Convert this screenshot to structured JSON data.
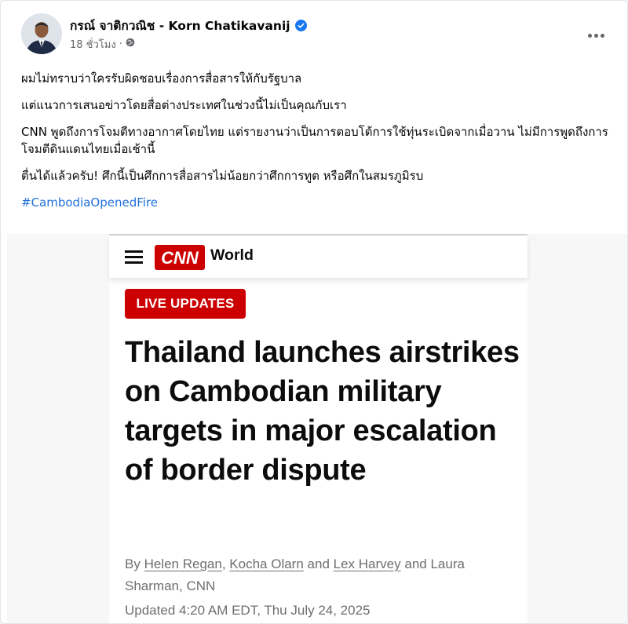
{
  "post": {
    "author_name": "กรณ์ จาติกวณิช - Korn Chatikavanij",
    "timestamp": "18 ชั่วโมง",
    "separator": "·",
    "paragraphs": [
      "ผมไม่ทราบว่าใครรับผิดชอบเรื่องการสื่อสารให้กับรัฐบาล",
      "แต่แนวการเสนอข่าวโดยสื่อต่างประเทศในช่วงนี้ไม่เป็นคุณกับเรา",
      "CNN พูดถึงการโจมตีทางอากาศโดยไทย แต่รายงานว่าเป็นการตอบโต้การใช้ทุ่นระเบิดจากเมื่อวาน ไม่มีการพูดถึงการโจมตีดินแดนไทยเมื่อเช้านี้",
      "ตื่นได้แล้วครับ! ศึกนี้เป็นศึกการสื่อสารไม่น้อยกว่าศึกการทูต หรือศึกในสมรภูมิรบ"
    ],
    "hashtag": "#CambodiaOpenedFire",
    "icons": {
      "verified": "verified-badge-icon",
      "audience": "globe-icon",
      "menu": "more-options-icon"
    }
  },
  "article": {
    "logo_text": "CNN",
    "section": "World",
    "badge": "LIVE UPDATES",
    "headline": "Thailand launches airstrikes on Cambodian military targets in major escalation of border dispute",
    "byline_prefix": "By",
    "authors": [
      "Helen Regan",
      "Kocha Olarn",
      "Lex Harvey",
      "Laura Sharman"
    ],
    "byline_sep1": ",",
    "byline_and1": "and",
    "byline_and2": "and",
    "byline_sep2": ",",
    "outlet": "CNN",
    "updated": "Updated 4:20 AM EDT, Thu July 24, 2025"
  },
  "colors": {
    "facebook_blue": "#1877f2",
    "hashtag_blue": "#216fdb",
    "cnn_red": "#cc0000",
    "muted_text": "#65676b"
  }
}
